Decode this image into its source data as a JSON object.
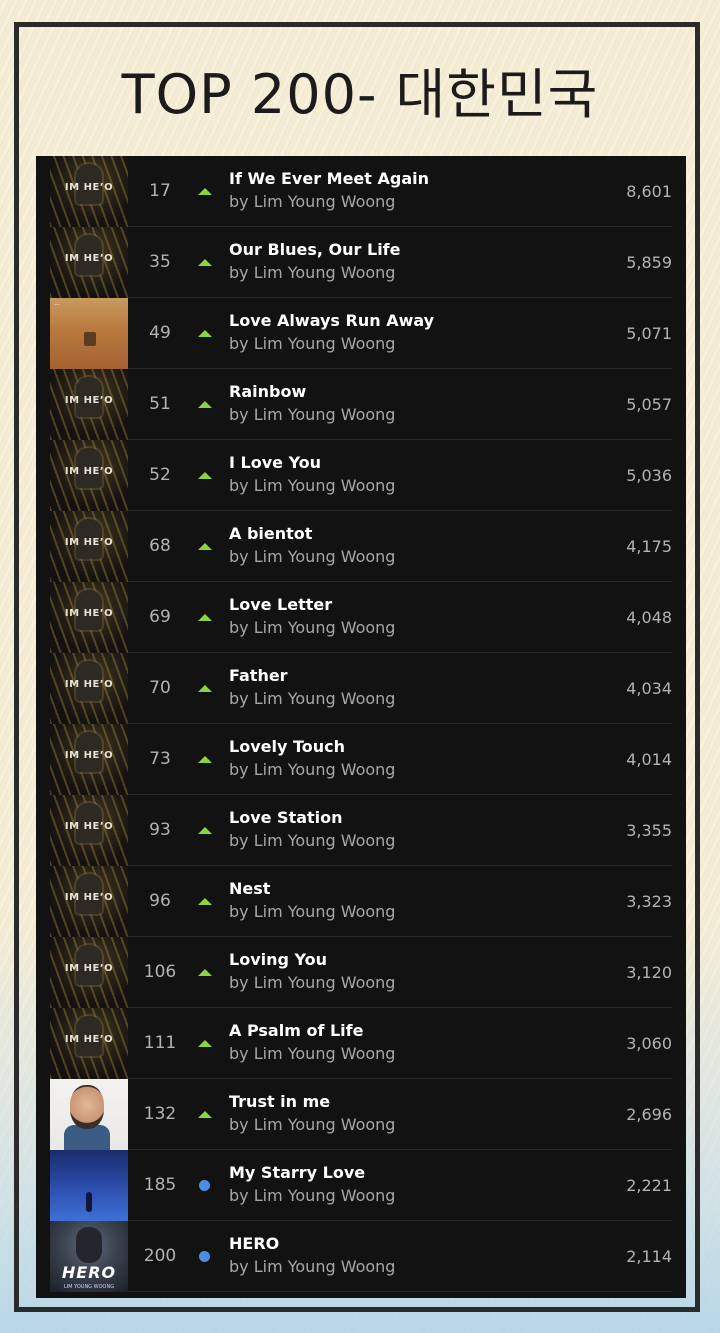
{
  "title": "TOP 200- 대한민국",
  "rows": [
    {
      "rank": "17",
      "trend": "up",
      "song": "If We Ever Meet Again",
      "artist": "by Lim Young Woong",
      "streams": "8,601",
      "art": "hero-dark",
      "art_text": "IM HE’O"
    },
    {
      "rank": "35",
      "trend": "up",
      "song": "Our Blues, Our Life",
      "artist": "by Lim Young Woong",
      "streams": "5,859",
      "art": "hero-dark",
      "art_text": "IM HE’O"
    },
    {
      "rank": "49",
      "trend": "up",
      "song": "Love Always Run Away",
      "artist": "by Lim Young Woong",
      "streams": "5,071",
      "art": "desert",
      "art_text": "—"
    },
    {
      "rank": "51",
      "trend": "up",
      "song": "Rainbow",
      "artist": "by Lim Young Woong",
      "streams": "5,057",
      "art": "hero-dark",
      "art_text": "IM HE’O"
    },
    {
      "rank": "52",
      "trend": "up",
      "song": "I Love You",
      "artist": "by Lim Young Woong",
      "streams": "5,036",
      "art": "hero-dark",
      "art_text": "IM HE’O"
    },
    {
      "rank": "68",
      "trend": "up",
      "song": "A bientot",
      "artist": "by Lim Young Woong",
      "streams": "4,175",
      "art": "hero-dark",
      "art_text": "IM HE’O"
    },
    {
      "rank": "69",
      "trend": "up",
      "song": "Love Letter",
      "artist": "by Lim Young Woong",
      "streams": "4,048",
      "art": "hero-dark",
      "art_text": "IM HE’O"
    },
    {
      "rank": "70",
      "trend": "up",
      "song": "Father",
      "artist": "by Lim Young Woong",
      "streams": "4,034",
      "art": "hero-dark",
      "art_text": "IM HE’O"
    },
    {
      "rank": "73",
      "trend": "up",
      "song": "Lovely Touch",
      "artist": "by Lim Young Woong",
      "streams": "4,014",
      "art": "hero-dark",
      "art_text": "IM HE’O"
    },
    {
      "rank": "93",
      "trend": "up",
      "song": "Love Station",
      "artist": "by Lim Young Woong",
      "streams": "3,355",
      "art": "hero-dark",
      "art_text": "IM HE’O"
    },
    {
      "rank": "96",
      "trend": "up",
      "song": "Nest",
      "artist": "by Lim Young Woong",
      "streams": "3,323",
      "art": "hero-dark",
      "art_text": "IM HE’O"
    },
    {
      "rank": "106",
      "trend": "up",
      "song": "Loving You",
      "artist": "by Lim Young Woong",
      "streams": "3,120",
      "art": "hero-dark",
      "art_text": "IM HE’O"
    },
    {
      "rank": "111",
      "trend": "up",
      "song": "A Psalm of Life",
      "artist": "by Lim Young Woong",
      "streams": "3,060",
      "art": "hero-dark",
      "art_text": "IM HE’O"
    },
    {
      "rank": "132",
      "trend": "up",
      "song": "Trust in me",
      "artist": "by Lim Young Woong",
      "streams": "2,696",
      "art": "portrait",
      "art_text": ""
    },
    {
      "rank": "185",
      "trend": "new",
      "song": "My Starry Love",
      "artist": "by Lim Young Woong",
      "streams": "2,221",
      "art": "blue",
      "art_text": ""
    },
    {
      "rank": "200",
      "trend": "new",
      "song": "HERO",
      "artist": "by Lim Young Woong",
      "streams": "2,114",
      "art": "hero-final",
      "art_text": "HERO",
      "art_subtext": "LIM YOUNG WOONG"
    }
  ],
  "colors": {
    "trend_up": "#8bd43d",
    "trend_new": "#4a90e2",
    "panel": "#121212"
  }
}
